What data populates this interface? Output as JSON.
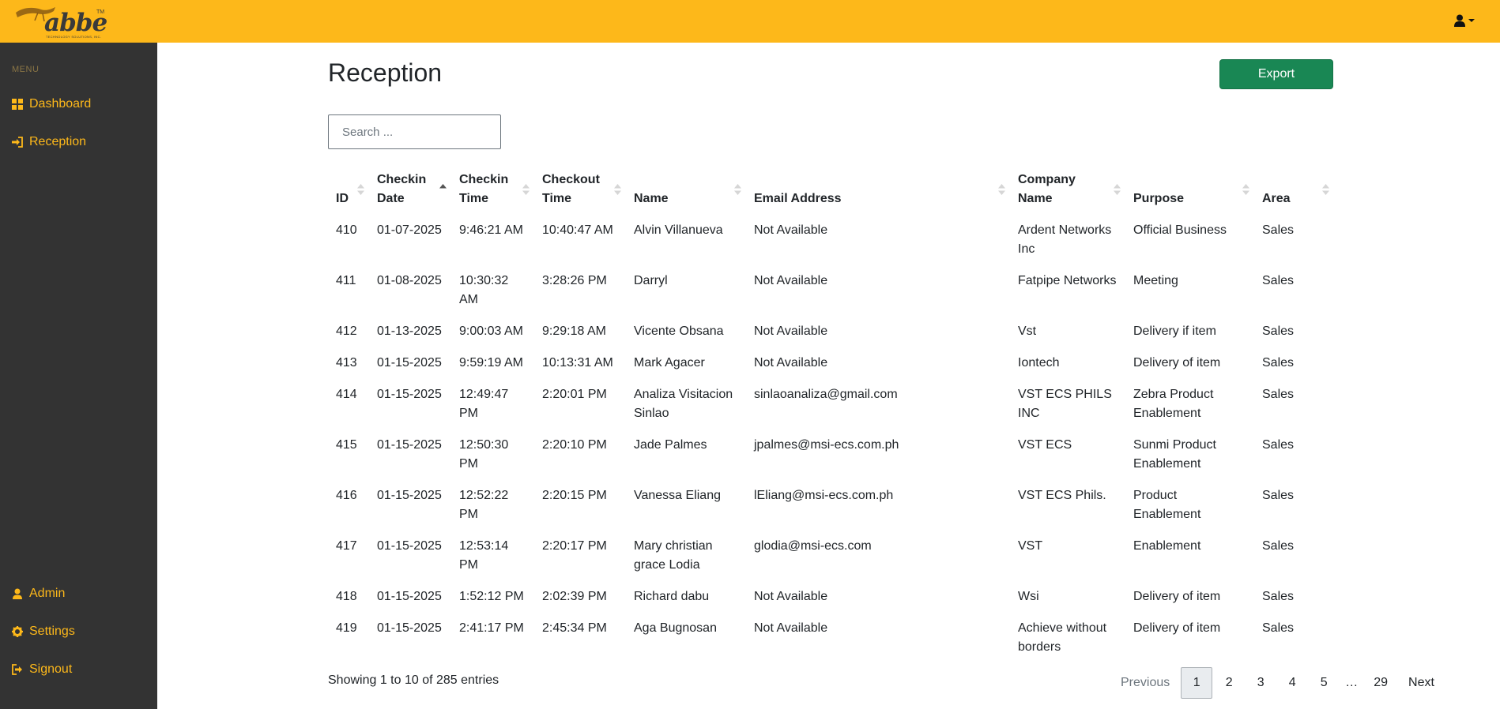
{
  "brand": {
    "logo_text": "abbe",
    "logo_tm": "TM",
    "logo_sub": "TECHNOLOGY SOLUTIONS, INC.",
    "colors": {
      "topbar": "#fdb81a",
      "sidebar": "#333333",
      "accent": "#fdb81a",
      "export": "#198754"
    }
  },
  "header": {
    "user_icon": "user-icon"
  },
  "sidebar": {
    "menu_label": "MENU",
    "items": [
      {
        "label": "Dashboard",
        "icon": "dashboard-icon"
      },
      {
        "label": "Reception",
        "icon": "sign-in-icon"
      },
      {
        "label": "Admin",
        "icon": "user-icon"
      },
      {
        "label": "Settings",
        "icon": "gear-icon"
      },
      {
        "label": "Signout",
        "icon": "sign-out-icon"
      }
    ]
  },
  "main": {
    "title": "Reception",
    "export_label": "Export",
    "search_placeholder": "Search ...",
    "columns": [
      {
        "line1": "",
        "line2": "ID"
      },
      {
        "line1": "Checkin",
        "line2": "Date"
      },
      {
        "line1": "Checkin",
        "line2": "Time"
      },
      {
        "line1": "Checkout",
        "line2": "Time"
      },
      {
        "line1": "",
        "line2": "Name"
      },
      {
        "line1": "",
        "line2": "Email Address"
      },
      {
        "line1": "Company",
        "line2": "Name"
      },
      {
        "line1": "",
        "line2": "Purpose"
      },
      {
        "line1": "",
        "line2": "Area"
      }
    ],
    "sorted_column": 1,
    "rows": [
      [
        "410",
        "01-07-2025",
        "9:46:21 AM",
        "10:40:47 AM",
        "Alvin Villanueva",
        "Not Available",
        "Ardent Networks Inc",
        "Official Business",
        "Sales"
      ],
      [
        "411",
        "01-08-2025",
        "10:30:32 AM",
        "3:28:26 PM",
        "Darryl",
        "Not Available",
        "Fatpipe Networks",
        "Meeting",
        "Sales"
      ],
      [
        "412",
        "01-13-2025",
        "9:00:03 AM",
        "9:29:18 AM",
        "Vicente Obsana",
        "Not Available",
        "Vst",
        "Delivery if item",
        "Sales"
      ],
      [
        "413",
        "01-15-2025",
        "9:59:19 AM",
        "10:13:31 AM",
        "Mark Agacer",
        "Not Available",
        "Iontech",
        "Delivery of item",
        "Sales"
      ],
      [
        "414",
        "01-15-2025",
        "12:49:47 PM",
        "2:20:01 PM",
        "Analiza Visitacion Sinlao",
        "sinlaoanaliza@gmail.com",
        "VST ECS PHILS INC",
        "Zebra Product Enablement",
        "Sales"
      ],
      [
        "415",
        "01-15-2025",
        "12:50:30 PM",
        "2:20:10 PM",
        "Jade Palmes",
        "jpalmes@msi-ecs.com.ph",
        "VST ECS",
        "Sunmi Product Enablement",
        "Sales"
      ],
      [
        "416",
        "01-15-2025",
        "12:52:22 PM",
        "2:20:15 PM",
        "Vanessa Eliang",
        "lEliang@msi-ecs.com.ph",
        "VST ECS Phils.",
        "Product Enablement",
        "Sales"
      ],
      [
        "417",
        "01-15-2025",
        "12:53:14 PM",
        "2:20:17 PM",
        "Mary christian grace Lodia",
        "glodia@msi-ecs.com",
        "VST",
        "Enablement",
        "Sales"
      ],
      [
        "418",
        "01-15-2025",
        "1:52:12 PM",
        "2:02:39 PM",
        "Richard dabu",
        "Not Available",
        "Wsi",
        "Delivery of item",
        "Sales"
      ],
      [
        "419",
        "01-15-2025",
        "2:41:17 PM",
        "2:45:34 PM",
        "Aga Bugnosan",
        "Not Available",
        "Achieve without borders",
        "Delivery of item",
        "Sales"
      ]
    ],
    "info": "Showing 1 to 10 of 285 entries",
    "pagination": {
      "previous": "Previous",
      "pages": [
        "1",
        "2",
        "3",
        "4",
        "5",
        "…",
        "29"
      ],
      "active": "1",
      "next": "Next"
    }
  }
}
